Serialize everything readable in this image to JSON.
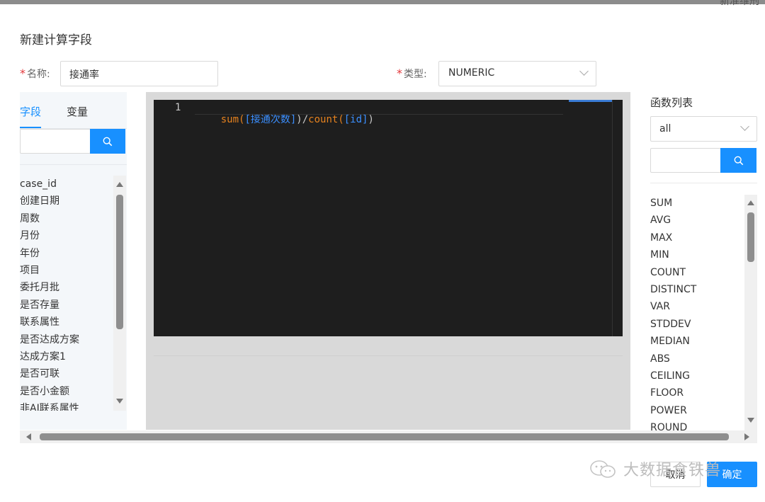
{
  "header": {
    "corner_text": "新准维刑"
  },
  "dialog": {
    "title": "新建计算字段"
  },
  "form": {
    "name_required": "*",
    "name_label": "名称:",
    "name_value": "接通率",
    "type_required": "*",
    "type_label": "类型:",
    "type_value": "NUMERIC"
  },
  "left": {
    "tabs": [
      {
        "label": "字段",
        "active": true
      },
      {
        "label": "变量",
        "active": false
      }
    ],
    "search_placeholder": "",
    "items": [
      "case_id",
      "创建日期",
      "周数",
      "月份",
      "年份",
      "项目",
      "委托月批",
      "是否存量",
      "联系属性",
      "是否达成方案",
      "达成方案1",
      "是否可联",
      "是否小金额",
      "非AI联系属性"
    ]
  },
  "editor": {
    "line_number": "1",
    "tokens": [
      {
        "text": "sum(",
        "kind": "fn"
      },
      {
        "text": "[接通次数]",
        "kind": "field"
      },
      {
        "text": ")/",
        "kind": "op"
      },
      {
        "text": "count(",
        "kind": "fn"
      },
      {
        "text": "[id]",
        "kind": "field"
      },
      {
        "text": ")",
        "kind": "op"
      }
    ]
  },
  "right": {
    "heading": "函数列表",
    "category_value": "all",
    "search_placeholder": "",
    "functions": [
      "SUM",
      "AVG",
      "MAX",
      "MIN",
      "COUNT",
      "DISTINCT",
      "VAR",
      "STDDEV",
      "MEDIAN",
      "ABS",
      "CEILING",
      "FLOOR",
      "POWER",
      "ROUND"
    ]
  },
  "footer": {
    "cancel_label": "取消",
    "ok_label": "确定",
    "watermark_text": "大数据食铁兽"
  },
  "colors": {
    "accent": "#1890ff",
    "required": "#e4393c",
    "editor_bg": "#1e1e1e",
    "fn_token": "#e6821e",
    "field_token": "#3b8fff"
  },
  "icons": {
    "search": "search-icon",
    "select_arrow": "chevron-down-icon",
    "watermark": "wechat-icon"
  }
}
